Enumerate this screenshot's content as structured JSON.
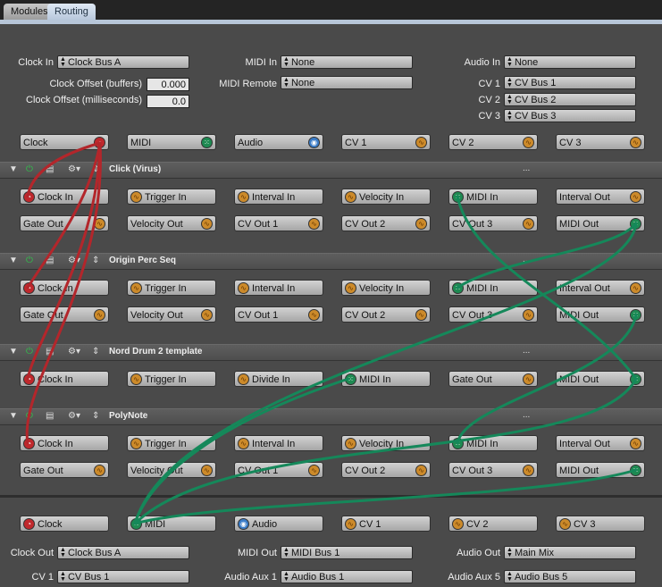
{
  "tabs": [
    {
      "label": "Modules"
    },
    {
      "label": "Routing"
    }
  ],
  "settings": {
    "clock_in_label": "Clock In",
    "clock_in_value": "Clock Bus A",
    "midi_in_label": "MIDI In",
    "midi_in_value": "None",
    "audio_in_label": "Audio In",
    "audio_in_value": "None",
    "clock_offset_buffers_label": "Clock Offset (buffers)",
    "clock_offset_buffers_value": "0.000",
    "clock_offset_ms_label": "Clock Offset (milliseconds)",
    "clock_offset_ms_value": "0.0",
    "midi_remote_label": "MIDI Remote",
    "midi_remote_value": "None",
    "cv1_label": "CV 1",
    "cv1_value": "CV Bus 1",
    "cv2_label": "CV 2",
    "cv2_value": "CV Bus 2",
    "cv3_label": "CV 3",
    "cv3_value": "CV Bus 3"
  },
  "input_ports": [
    "Clock",
    "MIDI",
    "Audio",
    "CV 1",
    "CV 2",
    "CV 3"
  ],
  "modules": [
    {
      "name": "Click (Virus)",
      "more": "...",
      "row1": [
        "Clock In",
        "Trigger In",
        "Interval In",
        "Velocity In",
        "MIDI In",
        "Interval Out"
      ],
      "row2": [
        "Gate Out",
        "Velocity Out",
        "CV Out 1",
        "CV Out 2",
        "CV Out 3",
        "MIDI Out"
      ]
    },
    {
      "name": "Origin Perc Seq",
      "more": "...",
      "row1": [
        "Clock In",
        "Trigger In",
        "Interval In",
        "Velocity In",
        "MIDI In",
        "Interval Out"
      ],
      "row2": [
        "Gate Out",
        "Velocity Out",
        "CV Out 1",
        "CV Out 2",
        "CV Out 3",
        "MIDI Out"
      ]
    },
    {
      "name": "Nord Drum 2 template",
      "more": "...",
      "row1": [
        "Clock In",
        "Trigger In",
        "Divide In",
        "MIDI In",
        "Gate Out",
        "MIDI Out"
      ]
    },
    {
      "name": "PolyNote",
      "more": "...",
      "row1": [
        "Clock In",
        "Trigger In",
        "Interval In",
        "Velocity In",
        "MIDI In",
        "Interval Out"
      ],
      "row2": [
        "Gate Out",
        "Velocity Out",
        "CV Out 1",
        "CV Out 2",
        "CV Out 3",
        "MIDI Out"
      ]
    }
  ],
  "output_ports": [
    "Clock",
    "MIDI",
    "Audio",
    "CV 1",
    "CV 2",
    "CV 3"
  ],
  "outputs": {
    "clock_out_label": "Clock Out",
    "clock_out_value": "Clock Bus A",
    "midi_out_label": "MIDI Out",
    "midi_out_value": "MIDI Bus 1",
    "audio_out_label": "Audio Out",
    "audio_out_value": "Main Mix",
    "cv1_label": "CV 1",
    "cv1_value": "CV Bus 1",
    "audio_aux1_label": "Audio Aux 1",
    "audio_aux1_value": "Audio Bus 1",
    "audio_aux5_label": "Audio Aux 5",
    "audio_aux5_value": "Audio Bus 5"
  },
  "colors": {
    "clock": "#c0282c",
    "cv": "#cc8a2a",
    "midi": "#1e8a52",
    "audio": "#3a7cc8",
    "clock_wire": "#b3262b",
    "midi_wire": "#15885a"
  }
}
